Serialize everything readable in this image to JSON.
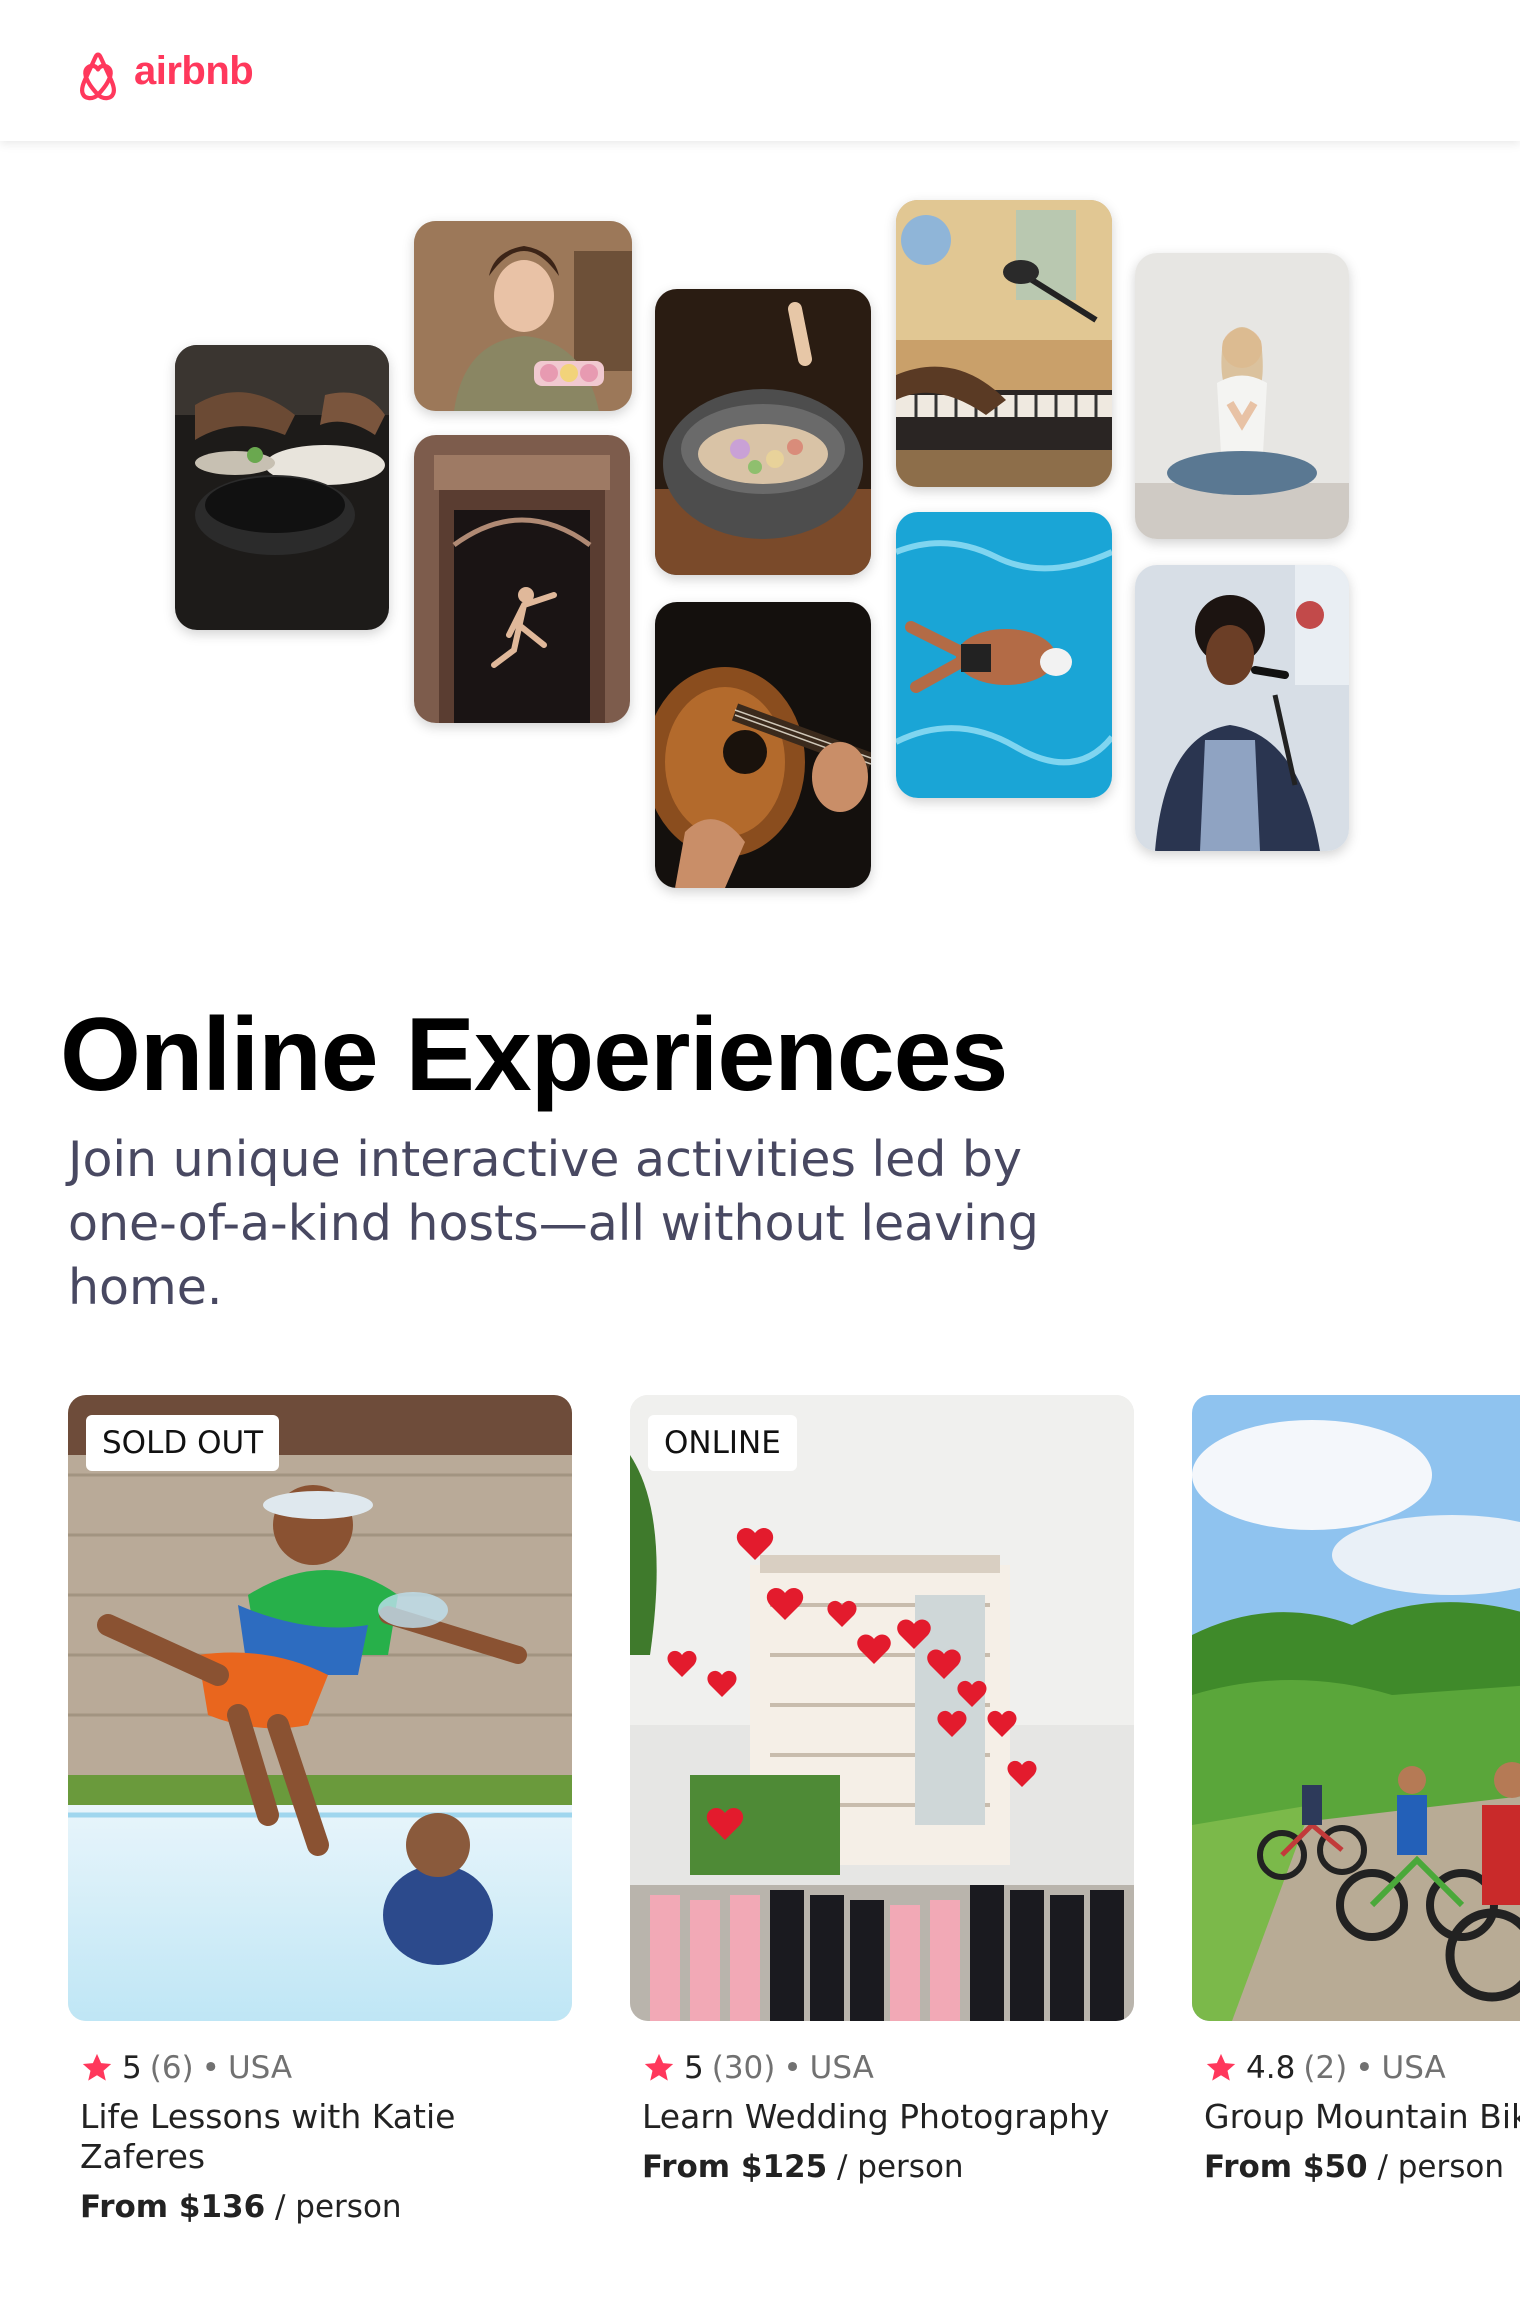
{
  "brand": {
    "name": "airbnb",
    "color": "#FF385C"
  },
  "collage_tiles": [
    "cooking-class-photo",
    "baker-with-macarons-photo",
    "dancer-in-doorway-photo",
    "food-bowl-photo",
    "guitar-player-photo",
    "keyboard-microphone-photo",
    "swimmer-pool-photo",
    "yoga-photo",
    "singer-photo"
  ],
  "hero": {
    "title": "Online Experiences",
    "subtitle": "Join unique interactive activities led by one-of-a-kind hosts—all without leaving home."
  },
  "cards": [
    {
      "badge": "SOLD OUT",
      "rating": "5",
      "count": "(6)",
      "dot": "•",
      "country": "USA",
      "title": "Life Lessons with Katie Zaferes",
      "price": "From $136",
      "unit": " / person"
    },
    {
      "badge": "ONLINE",
      "rating": "5",
      "count": "(30)",
      "dot": "•",
      "country": "USA",
      "title": "Learn Wedding Photography",
      "price": "From $125",
      "unit": " / person"
    },
    {
      "badge": "",
      "rating": "4.8",
      "count": "(2)",
      "dot": "•",
      "country": "USA",
      "title": "Group Mountain Bik",
      "price": "From $50",
      "unit": " / person"
    }
  ]
}
